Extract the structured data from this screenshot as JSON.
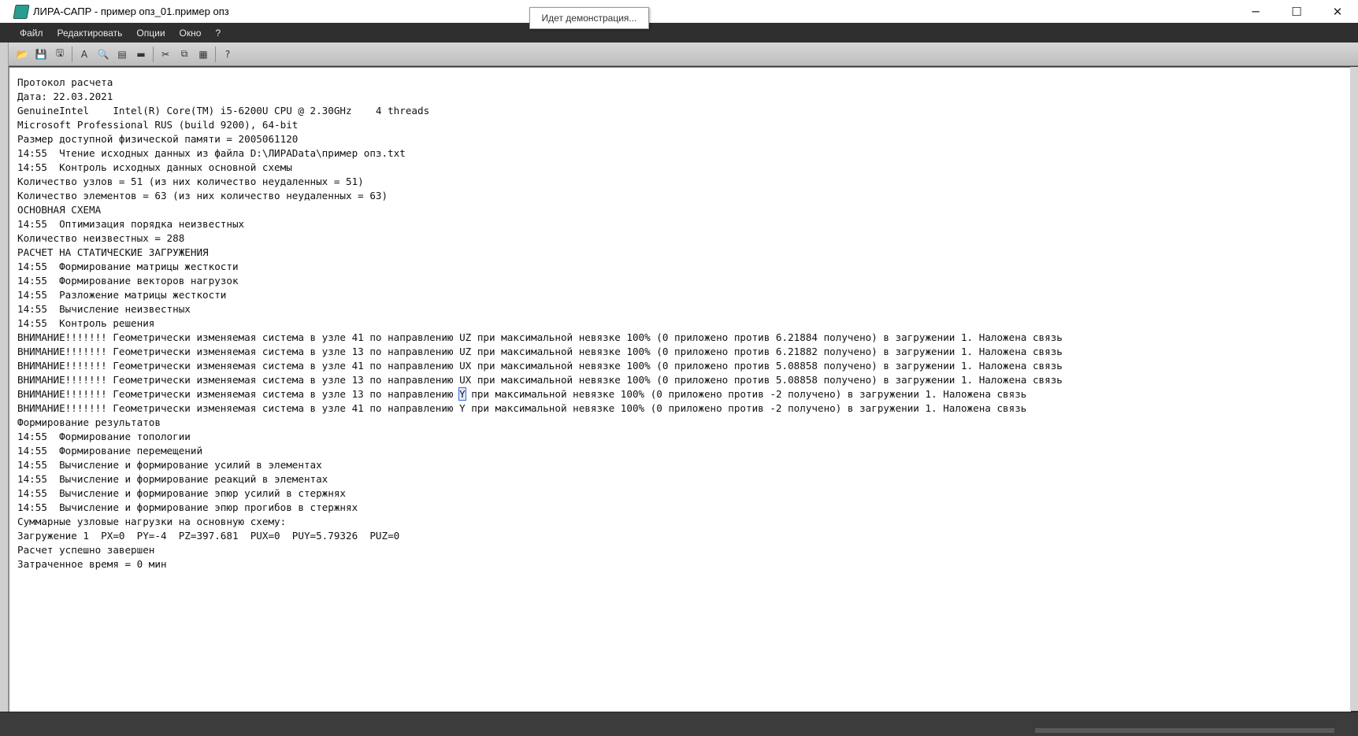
{
  "window": {
    "title": "ЛИРА-САПР - пример опз_01.пример опз",
    "minimize": "─",
    "maximize": "☐",
    "close": "✕"
  },
  "tooltip": "Идет демонстрация...",
  "menu": [
    "Файл",
    "Редактировать",
    "Опции",
    "Окно",
    "?"
  ],
  "toolbar": [
    {
      "name": "open-icon",
      "glyph": "📂"
    },
    {
      "name": "save-icon",
      "glyph": "💾"
    },
    {
      "name": "save-as-icon",
      "glyph": "🖫"
    },
    {
      "name": "font-icon",
      "glyph": "A"
    },
    {
      "name": "find-icon",
      "glyph": "🔍"
    },
    {
      "name": "print-preview-icon",
      "glyph": "▤"
    },
    {
      "name": "print-icon",
      "glyph": "▬"
    },
    {
      "name": "cut-icon",
      "glyph": "✂"
    },
    {
      "name": "copy-icon",
      "glyph": "⧉"
    },
    {
      "name": "paste-icon",
      "glyph": "▦"
    },
    {
      "name": "help-icon",
      "glyph": "?"
    }
  ],
  "log": {
    "before_cursor": "Протокол расчета\nДата: 22.03.2021\nGenuineIntel    Intel(R) Core(TM) i5-6200U CPU @ 2.30GHz    4 threads\nMicrosoft Professional RUS (build 9200), 64-bit\nРазмер доступной физической памяти = 2005061120\n14:55  Чтение исходных данных из файла D:\\ЛИРАData\\пример опз.txt\n14:55  Контроль исходных данных основной схемы\nКоличество узлов = 51 (из них количество неудаленных = 51)\nКоличество элементов = 63 (из них количество неудаленных = 63)\nОСНОВНАЯ СХЕМА\n14:55  Оптимизация порядка неизвестных\nКоличество неизвестных = 288\nРАСЧЕТ НА СТАТИЧЕСКИЕ ЗАГРУЖЕНИЯ\n14:55  Формирование матрицы жесткости\n14:55  Формирование векторов нагрузок\n14:55  Разложение матрицы жесткости\n14:55  Вычисление неизвестных\n14:55  Контроль решения\nВНИМАНИЕ!!!!!!! Геометрически изменяемая система в узле 41 по направлению UZ при максимальной невязке 100% (0 приложено против 6.21884 получено) в загружении 1. Наложена связь\nВНИМАНИЕ!!!!!!! Геометрически изменяемая система в узле 13 по направлению UZ при максимальной невязке 100% (0 приложено против 6.21882 получено) в загружении 1. Наложена связь\nВНИМАНИЕ!!!!!!! Геометрически изменяемая система в узле 41 по направлению UX при максимальной невязке 100% (0 приложено против 5.08858 получено) в загружении 1. Наложена связь\nВНИМАНИЕ!!!!!!! Геометрически изменяемая система в узле 13 по направлению UX при максимальной невязке 100% (0 приложено против 5.08858 получено) в загружении 1. Наложена связь\nВНИМАНИЕ!!!!!!! Геометрически изменяемая система в узле 13 по направлению ",
    "cursor_char": "Y",
    "after_cursor": " при максимальной невязке 100% (0 приложено против -2 получено) в загружении 1. Наложена связь\nВНИМАНИЕ!!!!!!! Геометрически изменяемая система в узле 41 по направлению Y при максимальной невязке 100% (0 приложено против -2 получено) в загружении 1. Наложена связь\nФормирование результатов\n14:55  Формирование топологии\n14:55  Формирование перемещений\n14:55  Вычисление и формирование усилий в элементах\n14:55  Вычисление и формирование реакций в элементах\n14:55  Вычисление и формирование эпюр усилий в стержнях\n14:55  Вычисление и формирование эпюр прогибов в стержнях\nСуммарные узловые нагрузки на основную схему:\nЗагружение 1  PX=0  PY=-4  PZ=397.681  PUX=0  PUY=5.79326  PUZ=0\nРасчет успешно завершен\nЗатраченное время = 0 мин"
  }
}
